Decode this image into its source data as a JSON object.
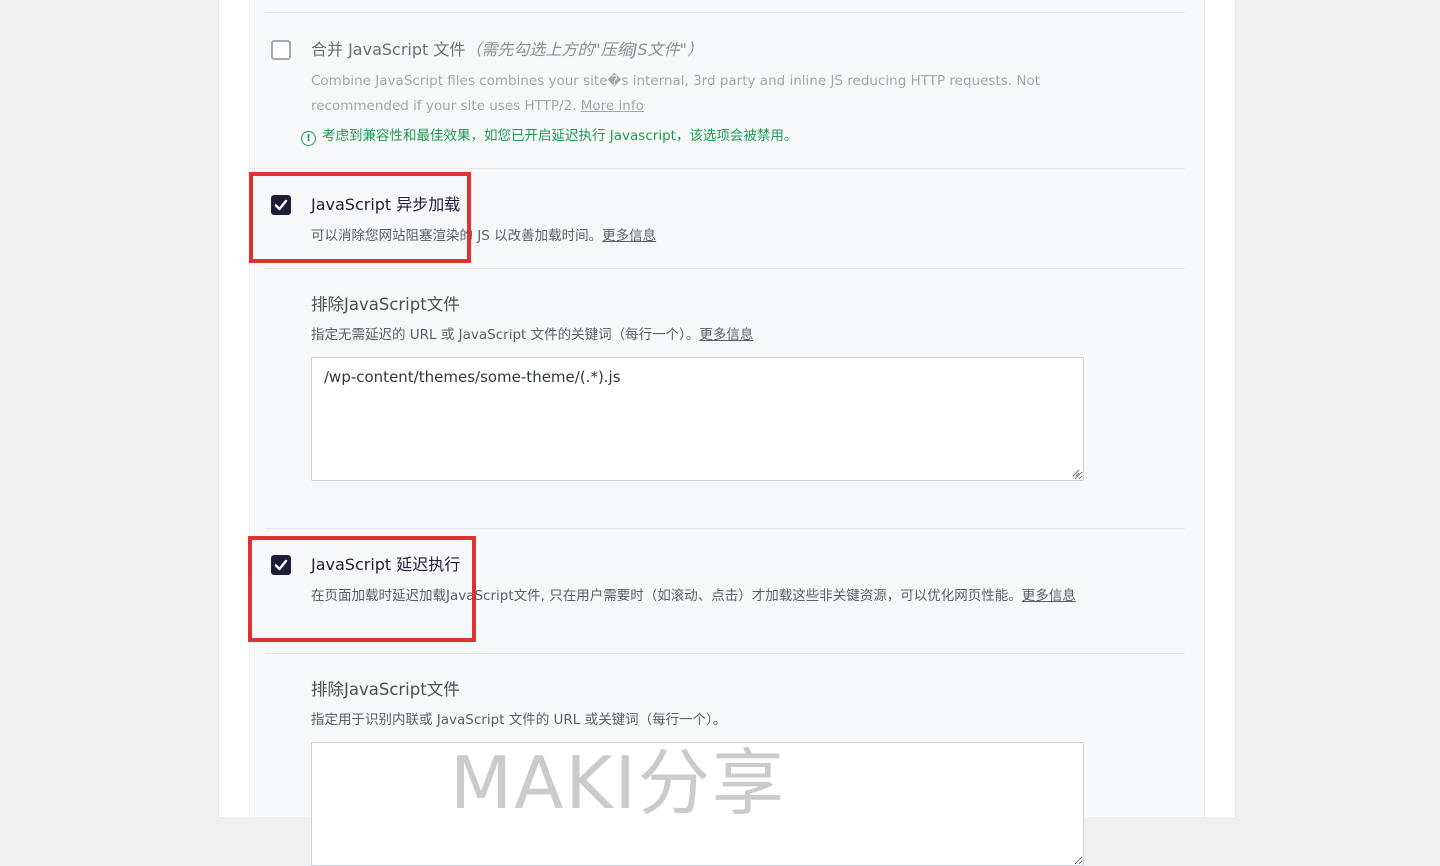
{
  "combine_js": {
    "label": "合并 JavaScript 文件",
    "note": "（需先勾选上方的\"压缩JS文件\"）",
    "description": "Combine JavaScript files combines your site�s internal, 3rd party and inline JS reducing HTTP requests. Not recommended if your site uses HTTP/2. ",
    "more_info": "More info",
    "warning": "考虑到兼容性和最佳效果，如您已开启延迟执行 Javascript，该选项会被禁用。",
    "checked": false
  },
  "async_js": {
    "label": "JavaScript 异步加载",
    "description": "可以消除您网站阻塞渲染的 JS 以改善加载时间。",
    "more_info": "更多信息",
    "checked": true
  },
  "async_exclude": {
    "title": "排除JavaScript文件",
    "description": "指定无需延迟的 URL 或 JavaScript 文件的关键词（每行一个）。",
    "more_info": "更多信息",
    "value": "/wp-content/themes/some-theme/(.*).js"
  },
  "delay_js": {
    "label": "JavaScript 延迟执行",
    "description": "在页面加载时延迟加载JavaScript文件, 只在用户需要时（如滚动、点击）才加载这些非关键资源，可以优化网页性能。",
    "more_info": "更多信息",
    "checked": true
  },
  "delay_exclude": {
    "title": "排除JavaScript文件",
    "description": "指定用于识别内联或 JavaScript 文件的 URL 或关键词（每行一个）。",
    "value": ""
  },
  "watermark": "MAKI分享",
  "colors": {
    "accent": "#1d1d3a",
    "warning": "#1d9a52",
    "highlight": "#e03131"
  }
}
